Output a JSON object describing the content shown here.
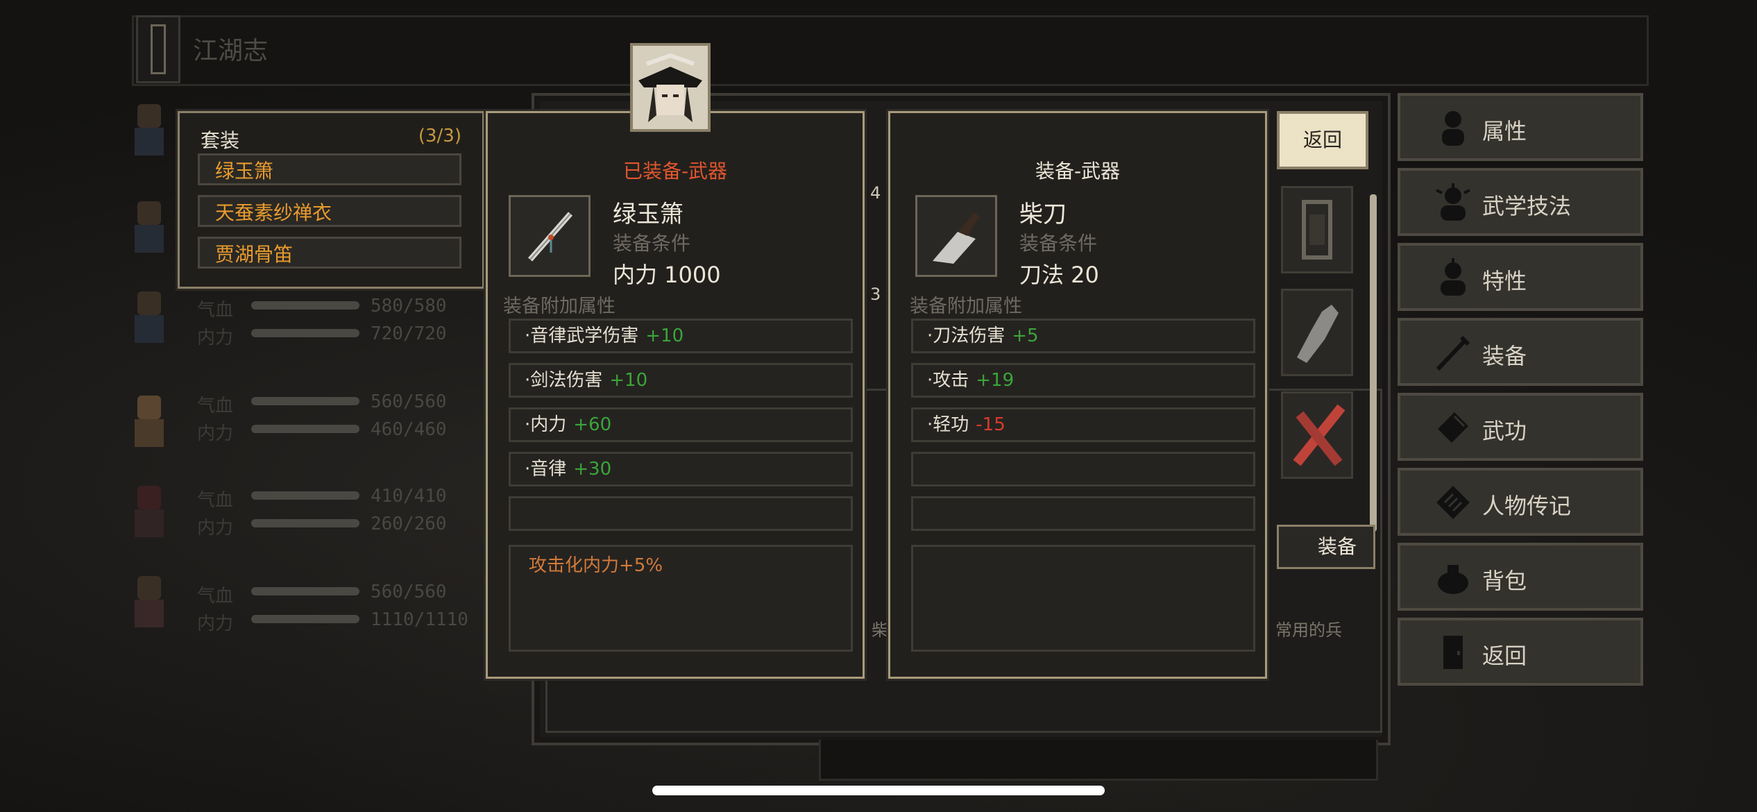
{
  "header": {
    "title": "江湖志"
  },
  "party": [
    {
      "hp_label": "气血",
      "hp": "580/580",
      "mp_label": "内力",
      "mp": "720/720"
    },
    {
      "hp_label": "气血",
      "hp": "560/560",
      "mp_label": "内力",
      "mp": "460/460"
    },
    {
      "hp_label": "气血",
      "hp": "410/410",
      "mp_label": "内力",
      "mp": "260/260"
    },
    {
      "hp_label": "气血",
      "hp": "560/560",
      "mp_label": "内力",
      "mp": "1110/1110"
    }
  ],
  "set_panel": {
    "title": "套装",
    "count": "(3/3)",
    "items": [
      "绿玉箫",
      "天蚕素纱禅衣",
      "贾湖骨笛"
    ]
  },
  "equipped_card": {
    "header": "已装备-武器",
    "name": "绿玉箫",
    "req_label": "装备条件",
    "req": "内力  1000",
    "attr_label": "装备附加属性",
    "attrs": [
      {
        "name": "·音律武学伤害",
        "value": "+10"
      },
      {
        "name": "·剑法伤害",
        "value": "+10"
      },
      {
        "name": "·内力",
        "value": "+60"
      },
      {
        "name": "·音律",
        "value": "+30"
      }
    ],
    "description": "攻击化内力+5%"
  },
  "compare_card": {
    "header": "装备-武器",
    "name": "柴刀",
    "req_label": "装备条件",
    "req": "刀法  20",
    "attr_label": "装备附加属性",
    "attrs": [
      {
        "name": "·刀法伤害",
        "value": "+5"
      },
      {
        "name": "·攻击",
        "value": "+19"
      },
      {
        "name": "·轻功",
        "value": "-15"
      }
    ]
  },
  "slot_panel": {
    "return_label": "返回",
    "equip_label": "装备",
    "fragment_text": "常用的兵",
    "side_marks": [
      "4",
      "3"
    ],
    "side_glyph": "柴"
  },
  "menu": [
    {
      "label": "属性",
      "icon": "person-icon"
    },
    {
      "label": "武学技法",
      "icon": "martial-skill-icon"
    },
    {
      "label": "特性",
      "icon": "trait-icon"
    },
    {
      "label": "装备",
      "icon": "sword-icon"
    },
    {
      "label": "武功",
      "icon": "book-icon"
    },
    {
      "label": "人物传记",
      "icon": "biography-icon"
    },
    {
      "label": "背包",
      "icon": "bag-icon"
    },
    {
      "label": "返回",
      "icon": "door-icon"
    }
  ],
  "colors": {
    "equipped_header": "#e0562e",
    "set_item_text": "#e89b2e",
    "positive": "#3aa53a",
    "negative": "#d93a2e",
    "description": "#d27a3a"
  }
}
